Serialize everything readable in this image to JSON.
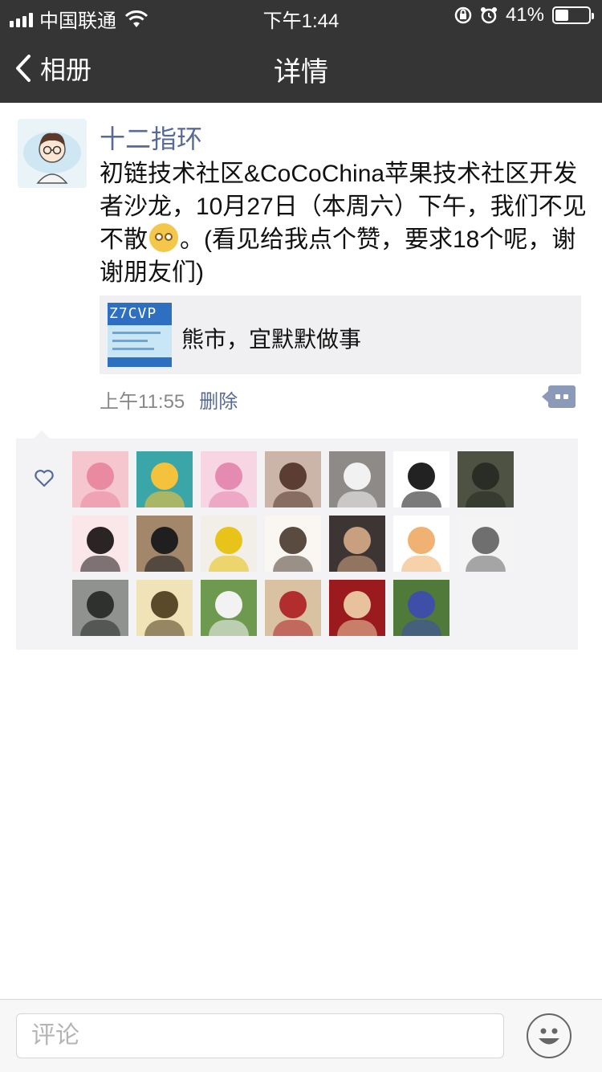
{
  "status_bar": {
    "carrier": "中国联通",
    "time": "下午1:44",
    "battery": "41%",
    "battery_level": 0.41
  },
  "nav": {
    "back_label": "相册",
    "title": "详情"
  },
  "post": {
    "author": "十二指环",
    "text_before_emoji": "初链技术社区&CoCoChina苹果技术社区开发者沙龙，10月27日（本周六）下午，我们不见不散",
    "text_after_emoji": "。(看见给我点个赞，要求18个呢，谢谢朋友们)",
    "link": {
      "thumb_text": "Z7CVP",
      "title": "熊市，宜默默做事"
    },
    "time": "上午11:55",
    "delete_label": "删除"
  },
  "likes": {
    "count": 20,
    "avatars": [
      {
        "name": "avatar-peppa-pig",
        "bg": "#f6c6cf",
        "fg": "#e98aa0"
      },
      {
        "name": "avatar-teal-badge",
        "bg": "#3aa6a7",
        "fg": "#f4c23b"
      },
      {
        "name": "avatar-pink-panther",
        "bg": "#f7d5e2",
        "fg": "#e58ab0"
      },
      {
        "name": "avatar-girl-photo",
        "bg": "#cbb4a8",
        "fg": "#5b3d32"
      },
      {
        "name": "avatar-white-dog",
        "bg": "#8e8a88",
        "fg": "#f1f1f1"
      },
      {
        "name": "avatar-panda",
        "bg": "#ffffff",
        "fg": "#222222"
      },
      {
        "name": "avatar-soldier",
        "bg": "#4d5243",
        "fg": "#2a2d25"
      },
      {
        "name": "avatar-cartoon-girl",
        "bg": "#fbe7ea",
        "fg": "#2b2424"
      },
      {
        "name": "avatar-man-glasses",
        "bg": "#a3876b",
        "fg": "#1f1f1f"
      },
      {
        "name": "avatar-man-corn",
        "bg": "#f2efe9",
        "fg": "#e8c31a"
      },
      {
        "name": "avatar-sketch-boy",
        "bg": "#faf7f2",
        "fg": "#5a4b40"
      },
      {
        "name": "avatar-man-sofa",
        "bg": "#3c3533",
        "fg": "#c9a07f"
      },
      {
        "name": "avatar-bear",
        "bg": "#ffffff",
        "fg": "#f0b272"
      },
      {
        "name": "avatar-line-art",
        "bg": "#f4f4f4",
        "fg": "#6f6f6f"
      },
      {
        "name": "avatar-eagle-statue",
        "bg": "#8f928f",
        "fg": "#2f312f"
      },
      {
        "name": "avatar-sketch-couple",
        "bg": "#f1e3b8",
        "fg": "#5a4a2a"
      },
      {
        "name": "avatar-baby-grass",
        "bg": "#6d9a4e",
        "fg": "#f2f2f2"
      },
      {
        "name": "avatar-car-road",
        "bg": "#d8c2a2",
        "fg": "#b22d2d"
      },
      {
        "name": "avatar-wedding-red",
        "bg": "#9b1a1e",
        "fg": "#e7c29c"
      },
      {
        "name": "avatar-irises",
        "bg": "#4f7a3a",
        "fg": "#3f4fa8"
      }
    ]
  },
  "bottom": {
    "comment_placeholder": "评论"
  }
}
